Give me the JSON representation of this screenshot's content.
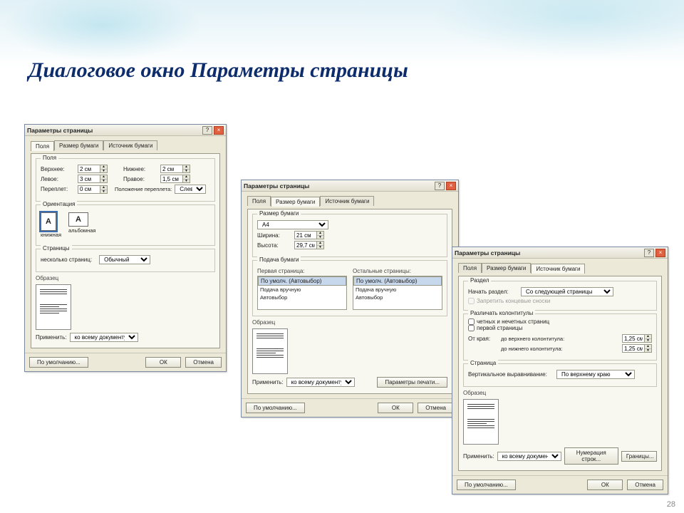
{
  "slide": {
    "title": "Диалоговое окно Параметры страницы",
    "num": "28"
  },
  "dialog_title": "Параметры страницы",
  "tabs": {
    "fields": "Поля",
    "paper": "Размер бумаги",
    "source": "Источник бумаги"
  },
  "common": {
    "sample": "Образец",
    "apply": "Применить:",
    "apply_val": "ко всему документу",
    "default": "По умолчанию...",
    "ok": "ОК",
    "cancel": "Отмена"
  },
  "d1": {
    "fields_legend": "Поля",
    "top": "Верхнее:",
    "top_v": "2 см",
    "bottom": "Нижнее:",
    "bottom_v": "2 см",
    "left": "Левое:",
    "left_v": "3 см",
    "right": "Правое:",
    "right_v": "1,5 см",
    "gutter": "Переплет:",
    "gutter_v": "0 см",
    "gutter_pos": "Положение переплета:",
    "gutter_pos_v": "Слева",
    "orient_legend": "Ориентация",
    "portrait": "книжная",
    "landscape": "альбомная",
    "pages_legend": "Страницы",
    "multi": "несколько страниц:",
    "multi_v": "Обычный"
  },
  "d2": {
    "size_legend": "Размер бумаги",
    "size_v": "A4",
    "width": "Ширина:",
    "width_v": "21 см",
    "height": "Высота:",
    "height_v": "29,7 см",
    "tray_legend": "Подача бумаги",
    "first": "Первая страница:",
    "other": "Остальные страницы:",
    "opt1": "По умолч. (Автовыбор)",
    "opt2": "Подача вручную",
    "opt3": "Автовыбор",
    "print_opts": "Параметры печати..."
  },
  "d3": {
    "section_legend": "Раздел",
    "start": "Начать раздел:",
    "start_v": "Со следующей страницы",
    "suppress": "Запретить концевые сноски",
    "hf_legend": "Различать колонтитулы",
    "diff_odd": "четных и нечетных страниц",
    "diff_first": "первой страницы",
    "from_edge": "От края:",
    "to_header": "до верхнего колонтитула:",
    "to_header_v": "1,25 см",
    "to_footer": "до нижнего колонтитула:",
    "to_footer_v": "1,25 см",
    "page_legend": "Страница",
    "valign": "Вертикальное выравнивание:",
    "valign_v": "По верхнему краю",
    "line_nums": "Нумерация строк...",
    "borders": "Границы..."
  }
}
